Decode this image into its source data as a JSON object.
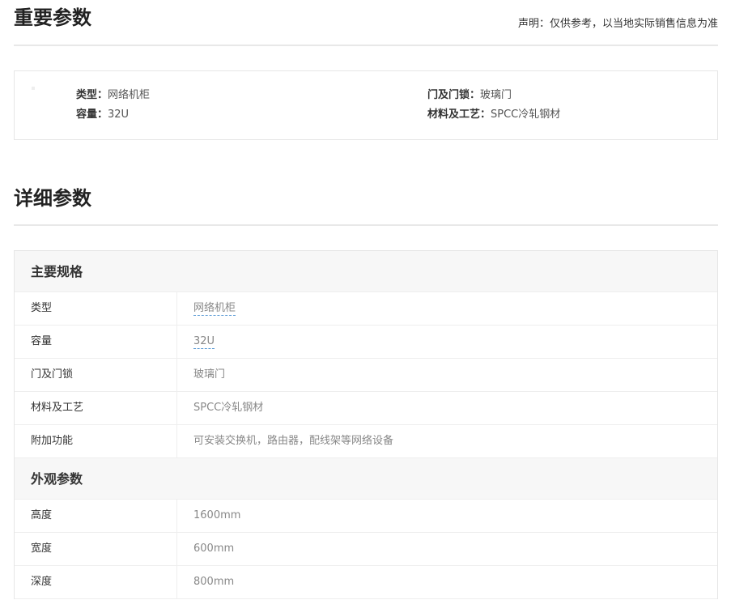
{
  "important": {
    "title": "重要参数",
    "disclaimer": "声明：仅供参考，以当地实际销售信息为准",
    "items": [
      {
        "key": "类型：",
        "value": "网络机柜"
      },
      {
        "key": "容量：",
        "value": "32U"
      },
      {
        "key": "门及门锁：",
        "value": "玻璃门"
      },
      {
        "key": "材料及工艺：",
        "value": "SPCC冷轧钢材"
      }
    ]
  },
  "detail": {
    "title": "详细参数",
    "groups": [
      {
        "title": "主要规格",
        "rows": [
          {
            "label": "类型",
            "value": "网络机柜",
            "linked": true
          },
          {
            "label": "容量",
            "value": "32U",
            "linked": true
          },
          {
            "label": "门及门锁",
            "value": "玻璃门",
            "linked": false
          },
          {
            "label": "材料及工艺",
            "value": "SPCC冷轧钢材",
            "linked": false
          },
          {
            "label": "附加功能",
            "value": "可安装交换机，路由器，配线架等网络设备",
            "linked": false
          }
        ]
      },
      {
        "title": "外观参数",
        "rows": [
          {
            "label": "高度",
            "value": "1600mm",
            "linked": false
          },
          {
            "label": "宽度",
            "value": "600mm",
            "linked": false
          },
          {
            "label": "深度",
            "value": "800mm",
            "linked": false
          }
        ]
      }
    ]
  },
  "colors": {
    "link_underline": "#5b9bd5",
    "value_text": "#888888",
    "group_bg": "#f7f7f7"
  }
}
